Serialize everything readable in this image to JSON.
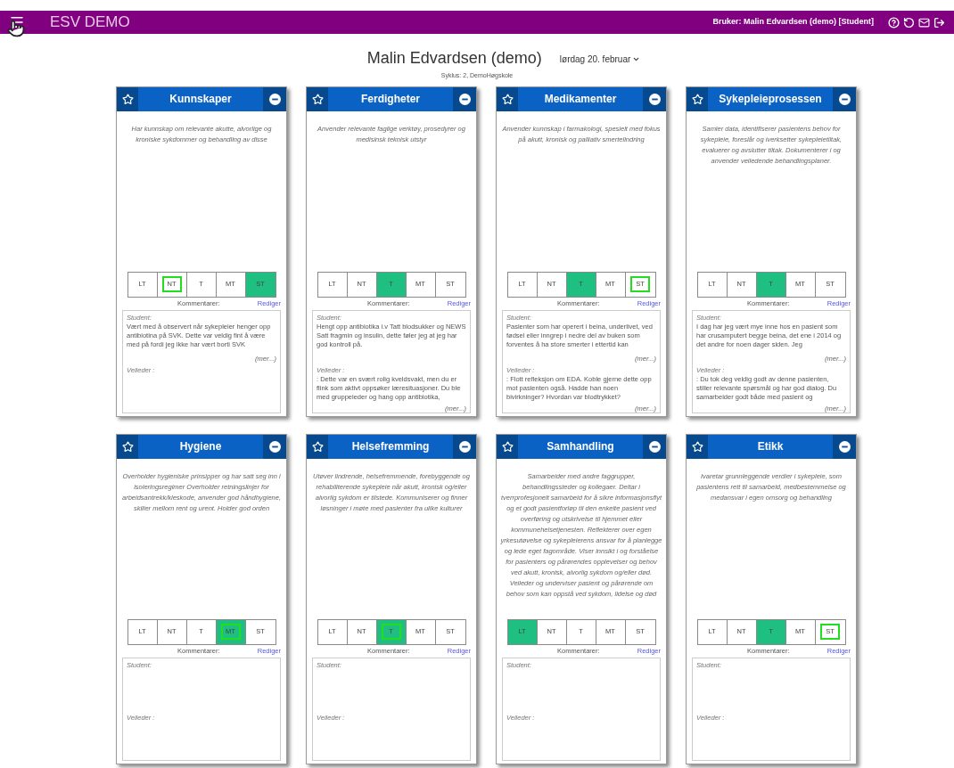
{
  "app_bar": {
    "title": "ESV DEMO",
    "user": "Bruker: Malin Edvardsen (demo) [Student]"
  },
  "student": {
    "name": "Malin Edvardsen (demo)",
    "date": "lørdag 20. februar",
    "subtitle": "Syklus: 2, DemoHøgskole"
  },
  "cards": [
    {
      "title": "Kunnskaper",
      "description": "Har kunnskap om relevante akutte, alvorlige og kroniske sykdommer og behandling av disse",
      "ratings": [
        {
          "label": "LT",
          "selected": false,
          "marked": false
        },
        {
          "label": "NT",
          "selected": false,
          "marked": true
        },
        {
          "label": "T",
          "selected": false,
          "marked": false
        },
        {
          "label": "MT",
          "selected": false,
          "marked": false
        },
        {
          "label": "ST",
          "selected": true,
          "marked": false
        }
      ],
      "comments_label": "Kommentarer:",
      "edit_link": "Rediger",
      "student_label": "Student:",
      "student_text": "Vært med å observert når sykepleier henger opp antibiotina på SVK. Dette var veldig fint å være med på fordi jeg ikke har vært borti SVK",
      "student_more": "(mer...)",
      "supervisor_label": "Veileder :"
    },
    {
      "title": "Ferdigheter",
      "description": "Anvender relevante faglige verktøy, prosedyrer og medisinsk teknisk utstyr",
      "ratings": [
        {
          "label": "LT",
          "selected": false,
          "marked": false
        },
        {
          "label": "NT",
          "selected": false,
          "marked": false
        },
        {
          "label": "T",
          "selected": true,
          "marked": false
        },
        {
          "label": "MT",
          "selected": false,
          "marked": false
        },
        {
          "label": "ST",
          "selected": false,
          "marked": false
        }
      ],
      "comments_label": "Kommentarer:",
      "edit_link": "Rediger",
      "student_label": "Student:",
      "student_text": "Hengt opp antibiotika i.v Tatt blodsukker og NEWS Satt fragmin og insulin, dette føler jeg at jeg har god kontroll på.",
      "supervisor_label": "Veileder :",
      "supervisor_text": ": Dette var en svært rolig kveldsvakt, men du er flink som aktivt oppsøker læresituasjoner. Du ble med gruppeleder og hang opp antibiotika,",
      "supervisor_more": "(mer...)"
    },
    {
      "title": "Medikamenter",
      "description": "Anvender kunnskap i farmakologi, spesielt med fokus på akutt, kronisk og palliativ smertelindring",
      "ratings": [
        {
          "label": "LT",
          "selected": false,
          "marked": false
        },
        {
          "label": "NT",
          "selected": false,
          "marked": false
        },
        {
          "label": "T",
          "selected": true,
          "marked": false
        },
        {
          "label": "MT",
          "selected": false,
          "marked": false
        },
        {
          "label": "ST",
          "selected": false,
          "marked": true
        }
      ],
      "comments_label": "Kommentarer:",
      "edit_link": "Rediger",
      "student_label": "Student:",
      "student_text": "Pasienter som har operert i beina, underlivet, ved fødsel eller inngrep i nedre del av buken som forventes å ha store smerter i ettertid kan",
      "student_more": "(mer...)",
      "supervisor_label": "Veileder :",
      "supervisor_text": ": Flott refleksjon om EDA. Koble gjerne dette opp mot pasienten også. Hadde han noen bivirkninger? Hvordan var blodtrykket?",
      "supervisor_more": "(mer...)"
    },
    {
      "title": "Sykepleieprosessen",
      "description": "Samler data, identifiserer pasientens behov for sykepleie, foreslår og iverksetter sykepleietiltak, evaluerer og avslutter tiltak. Dokumenterer i og anvender veiledende behandlingsplaner.",
      "ratings": [
        {
          "label": "LT",
          "selected": false,
          "marked": false
        },
        {
          "label": "NT",
          "selected": false,
          "marked": false
        },
        {
          "label": "T",
          "selected": true,
          "marked": false
        },
        {
          "label": "MT",
          "selected": false,
          "marked": false
        },
        {
          "label": "ST",
          "selected": false,
          "marked": false
        }
      ],
      "comments_label": "Kommentarer:",
      "edit_link": "Rediger",
      "student_label": "Student:",
      "student_text": "I dag har jeg vært mye inne hos en pasient som har crusamputert begge beina, det ene i 2014 og det andre for noen dager siden. Jeg",
      "student_more": "(mer...)",
      "supervisor_label": "Veileder :",
      "supervisor_text": ": Du tok deg veldig godt av denne pasienten, stiller relevante spørsmål og har god dialog. Du samarbeider godt både med pasient og",
      "supervisor_more": "(mer...)"
    },
    {
      "title": "Hygiene",
      "description": "Overholder hygieniske prinsipper og har satt seg inn i isoleringsregimer Overholder retningslinjer for arbeidsantrekk/kleskode, anvender god håndhygiene, skiller mellom rent og urent. Holder god orden",
      "ratings": [
        {
          "label": "LT",
          "selected": false,
          "marked": false
        },
        {
          "label": "NT",
          "selected": false,
          "marked": false
        },
        {
          "label": "T",
          "selected": false,
          "marked": false
        },
        {
          "label": "MT",
          "selected": true,
          "marked": true
        },
        {
          "label": "ST",
          "selected": false,
          "marked": false
        }
      ],
      "comments_label": "Kommentarer:",
      "edit_link": "Rediger",
      "student_label": "Student:",
      "supervisor_label": "Veileder :"
    },
    {
      "title": "Helsefremming",
      "description": "Utøver lindrende, helsefremmende, forebyggende og rehabiliterende sykepleie når akutt, kronisk og/eller alvorlig sykdom er tilstede. Kommuniserer og finner løsninger i møte med pasienter fra ulike kulturer",
      "ratings": [
        {
          "label": "LT",
          "selected": false,
          "marked": false
        },
        {
          "label": "NT",
          "selected": false,
          "marked": false
        },
        {
          "label": "T",
          "selected": true,
          "marked": true
        },
        {
          "label": "MT",
          "selected": false,
          "marked": false
        },
        {
          "label": "ST",
          "selected": false,
          "marked": false
        }
      ],
      "comments_label": "Kommentarer:",
      "edit_link": "Rediger",
      "student_label": "Student:",
      "supervisor_label": "Veileder :"
    },
    {
      "title": "Samhandling",
      "description": "Samarbeider med andre faggrupper, behandlingssteder og kollegaer. Deltar i tverrprofesjonelt samarbeid for å sikre informasjonsflyt og et godt pasientforløp til den enkelte pasient ved overføring og utskrivelse til hjemmet eller kommunehelsetjenesten. Reflekterer over egen yrkesutøvelse og sykepleierens ansvar for å planlegge og lede eget fagområde. Viser innsikt i og forståelse for pasienters og pårørendes opplevelser og behov ved akutt, kronisk, alvorlig sykdom og/eller død. Veileder og underviser pasient og pårørende om behov som kan oppstå ved sykdom, lidelse og død",
      "ratings": [
        {
          "label": "LT",
          "selected": true,
          "marked": false
        },
        {
          "label": "NT",
          "selected": false,
          "marked": false
        },
        {
          "label": "T",
          "selected": false,
          "marked": false
        },
        {
          "label": "MT",
          "selected": false,
          "marked": false
        },
        {
          "label": "ST",
          "selected": false,
          "marked": false
        }
      ],
      "comments_label": "Kommentarer:",
      "edit_link": "Rediger",
      "student_label": "Student:",
      "supervisor_label": "Veileder :"
    },
    {
      "title": "Etikk",
      "description": "Ivaretar grunnleggende verdier i sykepleie, som pasientens rett til samarbeid, medbestemmelse og medansvar i egen omsorg og behandling",
      "ratings": [
        {
          "label": "LT",
          "selected": false,
          "marked": false
        },
        {
          "label": "NT",
          "selected": false,
          "marked": false
        },
        {
          "label": "T",
          "selected": true,
          "marked": false
        },
        {
          "label": "MT",
          "selected": false,
          "marked": false
        },
        {
          "label": "ST",
          "selected": false,
          "marked": true
        }
      ],
      "comments_label": "Kommentarer:",
      "edit_link": "Rediger",
      "student_label": "Student:",
      "supervisor_label": "Veileder :"
    }
  ]
}
